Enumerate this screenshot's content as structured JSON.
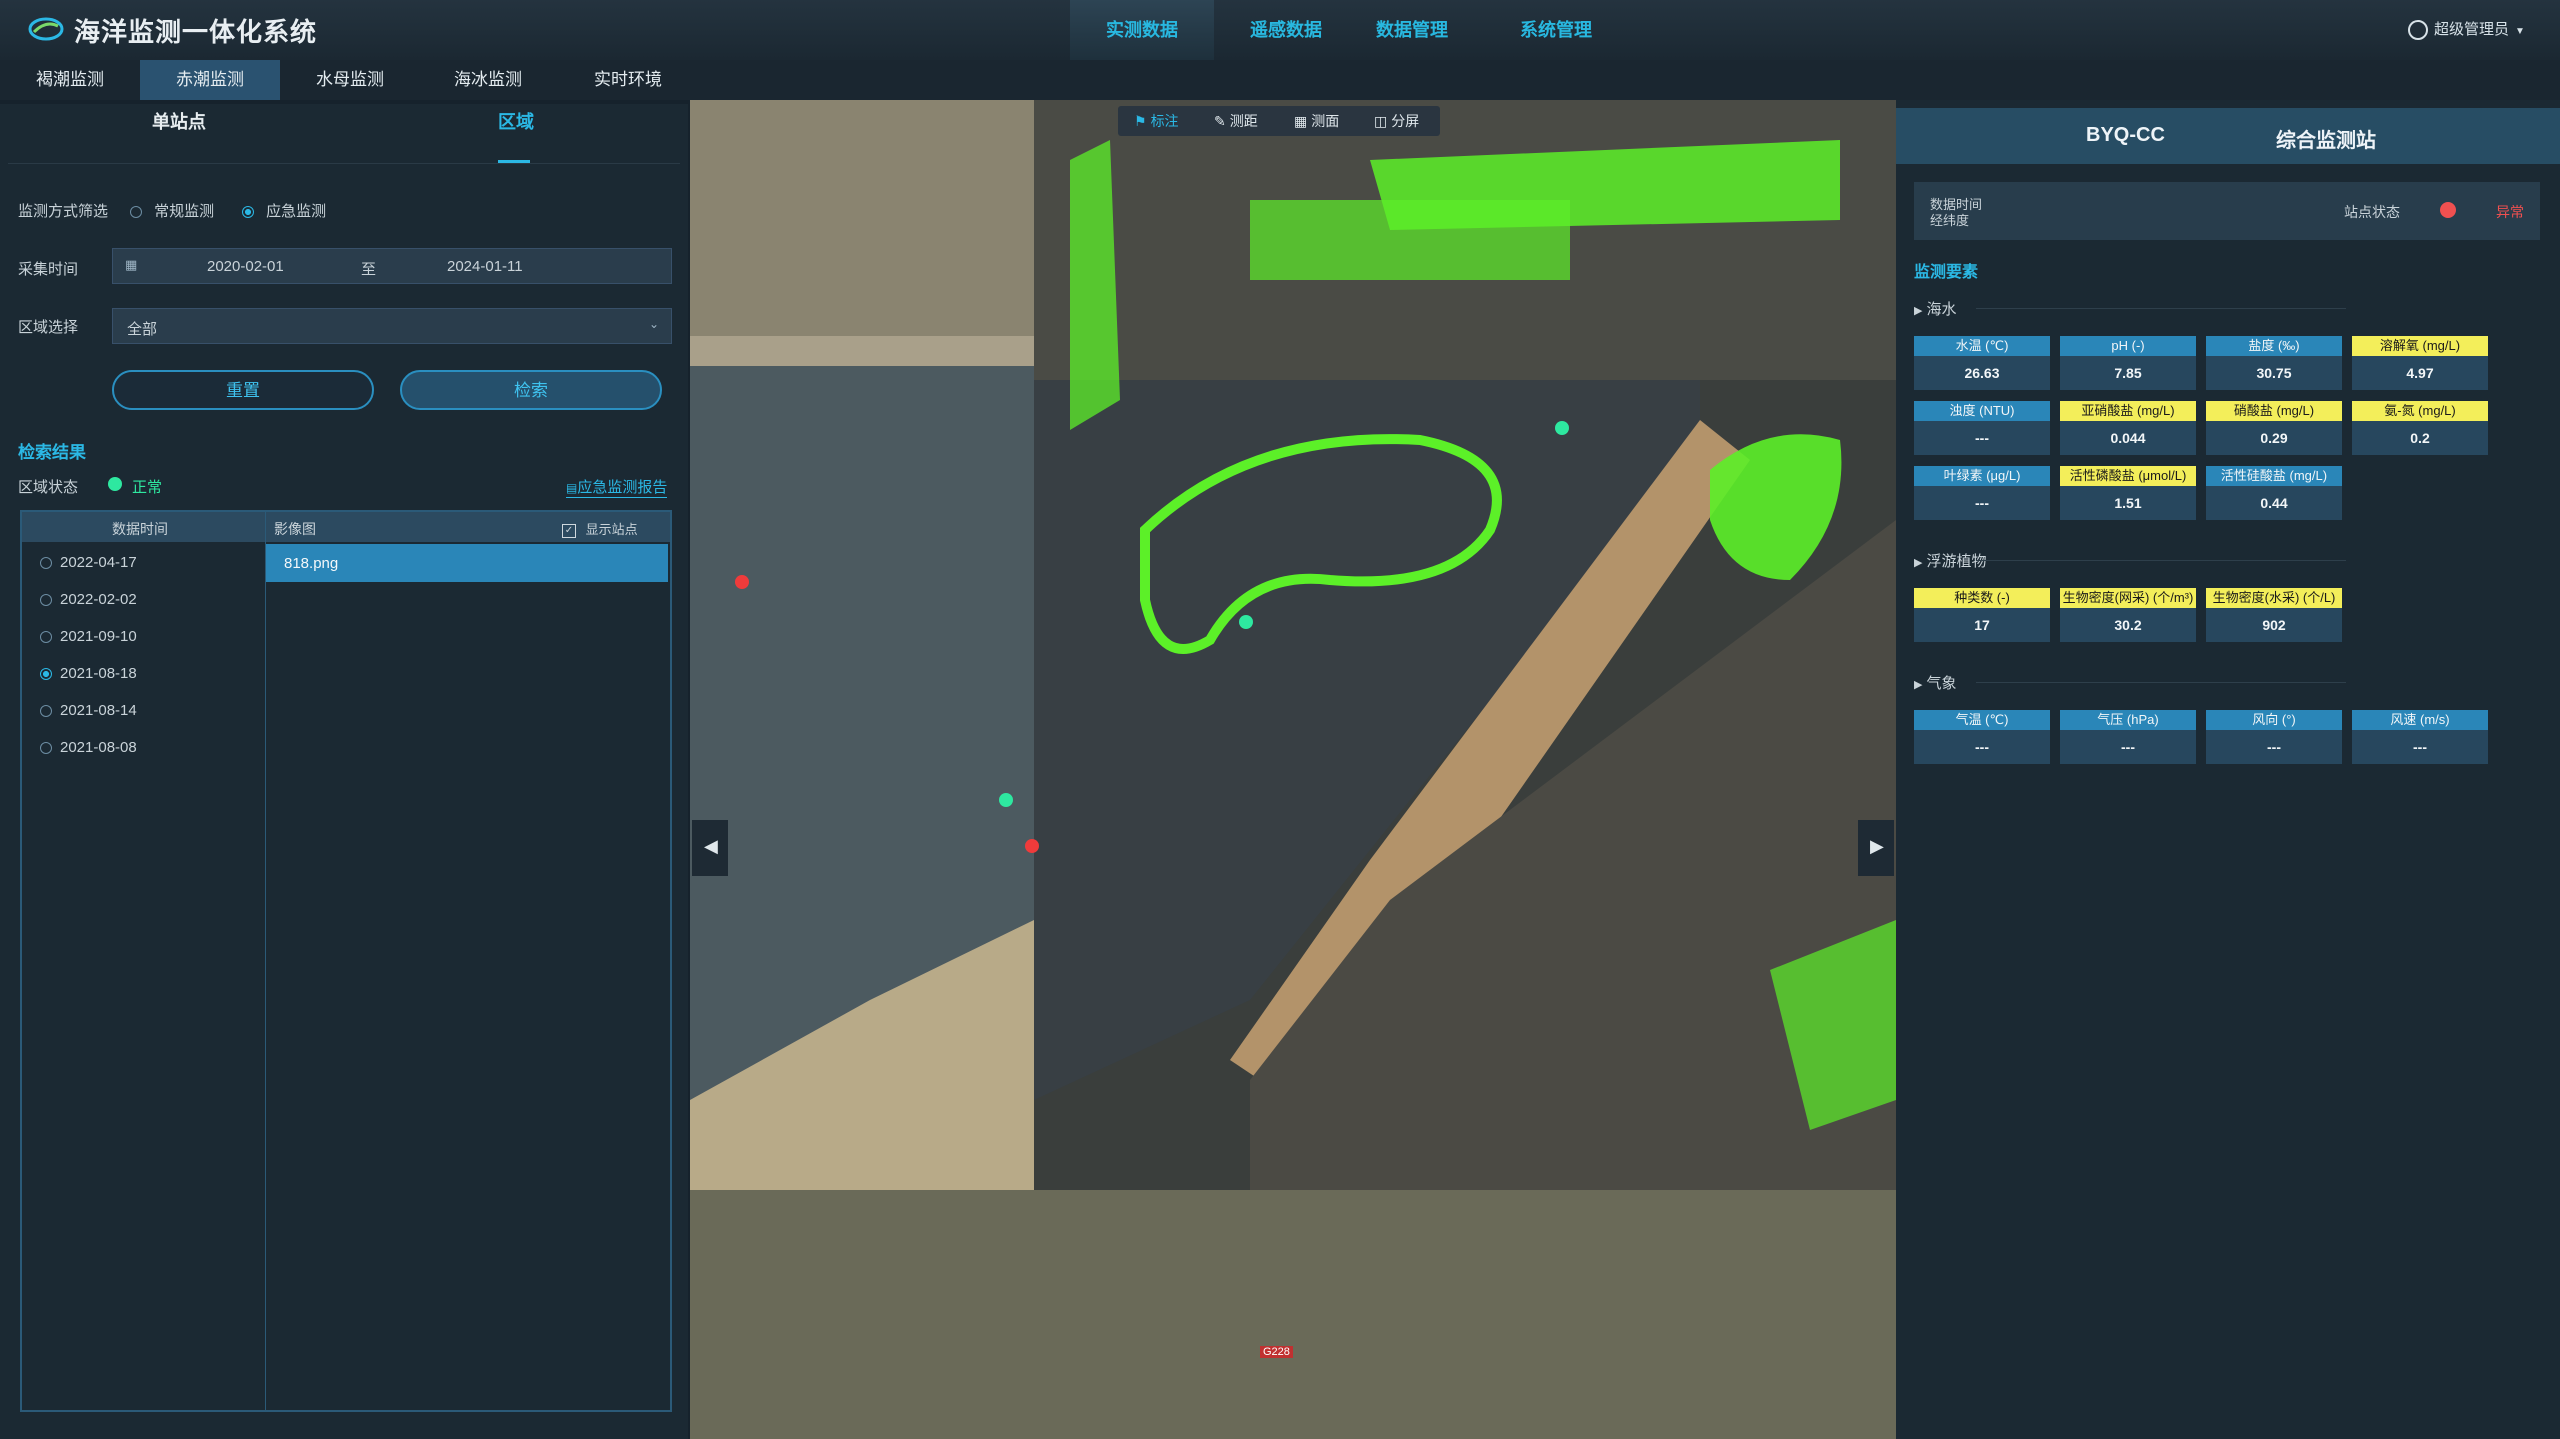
{
  "app": {
    "title": "海洋监测一体化系统"
  },
  "nav": [
    {
      "label": "实测数据",
      "active": true
    },
    {
      "label": "遥感数据",
      "active": false
    },
    {
      "label": "数据管理",
      "active": false
    },
    {
      "label": "系统管理",
      "active": false
    }
  ],
  "user": {
    "name": "超级管理员"
  },
  "subnav": [
    {
      "label": "褐潮监测",
      "active": false
    },
    {
      "label": "赤潮监测",
      "active": true
    },
    {
      "label": "水母监测",
      "active": false
    },
    {
      "label": "海冰监测",
      "active": false
    },
    {
      "label": "实时环境",
      "active": false
    }
  ],
  "left": {
    "tabs": {
      "single": "单站点",
      "region": "区域"
    },
    "filter": {
      "label": "监测方式筛选",
      "options": [
        {
          "label": "常规监测",
          "checked": false
        },
        {
          "label": "应急监测",
          "checked": true
        }
      ]
    },
    "time": {
      "label": "采集时间",
      "start": "2020-02-01",
      "sep": "至",
      "end": "2024-01-11"
    },
    "region": {
      "label": "区域选择",
      "value": "全部"
    },
    "buttons": {
      "reset": "重置",
      "search": "检索"
    },
    "results": {
      "title": "检索结果",
      "status_label": "区域状态",
      "status_value": "正常",
      "report_link": "应急监测报告",
      "col_time": "数据时间",
      "col_image": "影像图",
      "show_sites": "显示站点",
      "dates": [
        {
          "date": "2022-04-17",
          "selected": false
        },
        {
          "date": "2022-02-02",
          "selected": false
        },
        {
          "date": "2021-09-10",
          "selected": false
        },
        {
          "date": "2021-08-18",
          "selected": true
        },
        {
          "date": "2021-08-14",
          "selected": false
        },
        {
          "date": "2021-08-08",
          "selected": false
        }
      ],
      "image": "818.png"
    }
  },
  "map": {
    "toolbar": [
      "标注",
      "测距",
      "测面",
      "分屏"
    ],
    "labels": {
      "road": "G228"
    }
  },
  "right": {
    "station_code": "BYQ-CC",
    "station_name": "综合监测站",
    "info": {
      "time_label": "数据时间",
      "coord_label": "经纬度",
      "status_label": "站点状态",
      "status_value": "异常",
      "status_color": "#f05050"
    },
    "section_title": "监测要素",
    "groups": [
      {
        "name": "海水",
        "items": [
          {
            "label": "水温 (℃)",
            "value": "26.63",
            "highlight": false
          },
          {
            "label": "pH (-)",
            "value": "7.85",
            "highlight": false
          },
          {
            "label": "盐度 (‰)",
            "value": "30.75",
            "highlight": false
          },
          {
            "label": "溶解氧 (mg/L)",
            "value": "4.97",
            "highlight": true
          },
          {
            "label": "浊度 (NTU)",
            "value": "---",
            "highlight": false
          },
          {
            "label": "亚硝酸盐 (mg/L)",
            "value": "0.044",
            "highlight": true
          },
          {
            "label": "硝酸盐 (mg/L)",
            "value": "0.29",
            "highlight": true
          },
          {
            "label": "氨-氮 (mg/L)",
            "value": "0.2",
            "highlight": true
          },
          {
            "label": "叶绿素 (μg/L)",
            "value": "---",
            "highlight": false
          },
          {
            "label": "活性磷酸盐 (μmol/L)",
            "value": "1.51",
            "highlight": true
          },
          {
            "label": "活性硅酸盐 (mg/L)",
            "value": "0.44",
            "highlight": false
          }
        ]
      },
      {
        "name": "浮游植物",
        "items": [
          {
            "label": "种类数 (-)",
            "value": "17",
            "highlight": true
          },
          {
            "label": "生物密度(网采) (个/m³)",
            "value": "30.2",
            "highlight": true
          },
          {
            "label": "生物密度(水采) (个/L)",
            "value": "902",
            "highlight": true
          }
        ]
      },
      {
        "name": "气象",
        "items": [
          {
            "label": "气温 (℃)",
            "value": "---",
            "highlight": false
          },
          {
            "label": "气压 (hPa)",
            "value": "---",
            "highlight": false
          },
          {
            "label": "风向 (°)",
            "value": "---",
            "highlight": false
          },
          {
            "label": "风速 (m/s)",
            "value": "---",
            "highlight": false
          }
        ]
      }
    ]
  }
}
